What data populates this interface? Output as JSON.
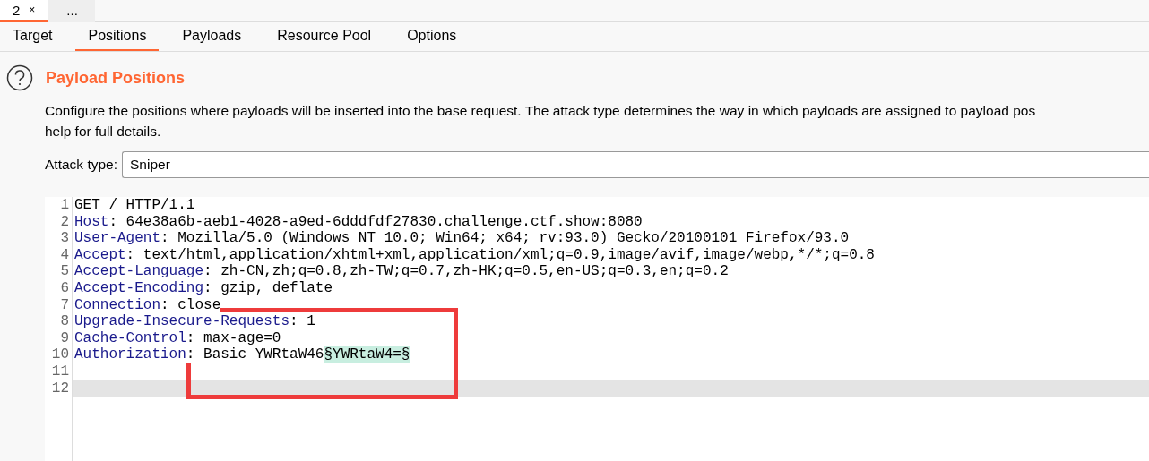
{
  "top_tabs": [
    {
      "label": "2",
      "close": "×",
      "selected": true
    },
    {
      "label": "...",
      "selected": false
    }
  ],
  "tabs": [
    {
      "label": "Target",
      "selected": false
    },
    {
      "label": "Positions",
      "selected": true
    },
    {
      "label": "Payloads",
      "selected": false
    },
    {
      "label": "Resource Pool",
      "selected": false
    },
    {
      "label": "Options",
      "selected": false
    }
  ],
  "section": {
    "title": "Payload Positions",
    "description_lines": [
      "Configure the positions where payloads will be inserted into the base request. The attack type determines the way in which payloads are assigned to payload pos",
      "help for full details."
    ]
  },
  "attack_type": {
    "label": "Attack type:",
    "value": "Sniper"
  },
  "editor": {
    "lines": [
      {
        "number": "1",
        "rest": "GET / HTTP/1.1",
        "selected": false
      },
      {
        "number": "2",
        "header": "Host",
        "rest": ": 64e38a6b-aeb1-4028-a9ed-6dddfdf27830.challenge.ctf.show:8080",
        "selected": false
      },
      {
        "number": "3",
        "header": "User-Agent",
        "rest": ": Mozilla/5.0 (Windows NT 10.0; Win64; x64; rv:93.0) Gecko/20100101 Firefox/93.0",
        "selected": false
      },
      {
        "number": "4",
        "header": "Accept",
        "rest": ": text/html,application/xhtml+xml,application/xml;q=0.9,image/avif,image/webp,*/*;q=0.8",
        "selected": false
      },
      {
        "number": "5",
        "header": "Accept-Language",
        "rest": ": zh-CN,zh;q=0.8,zh-TW;q=0.7,zh-HK;q=0.5,en-US;q=0.3,en;q=0.2",
        "selected": false
      },
      {
        "number": "6",
        "header": "Accept-Encoding",
        "rest": ": gzip, deflate",
        "selected": false
      },
      {
        "number": "7",
        "header": "Connection",
        "rest": ": close",
        "selected": false
      },
      {
        "number": "8",
        "header": "Upgrade-Insecure-Requests",
        "rest": ": 1",
        "selected": false
      },
      {
        "number": "9",
        "header": "Cache-Control",
        "rest": ": max-age=0",
        "selected": false
      },
      {
        "number": "10",
        "header": "Authorization",
        "rest": ": Basic YWRtaW46",
        "payload": "§YWRtaW4=§",
        "selected": false
      },
      {
        "number": "11",
        "selected": false
      },
      {
        "number": "12",
        "selected": true
      }
    ]
  },
  "annotation": {
    "kind": "rectangle",
    "color": "#ee3b3b"
  }
}
